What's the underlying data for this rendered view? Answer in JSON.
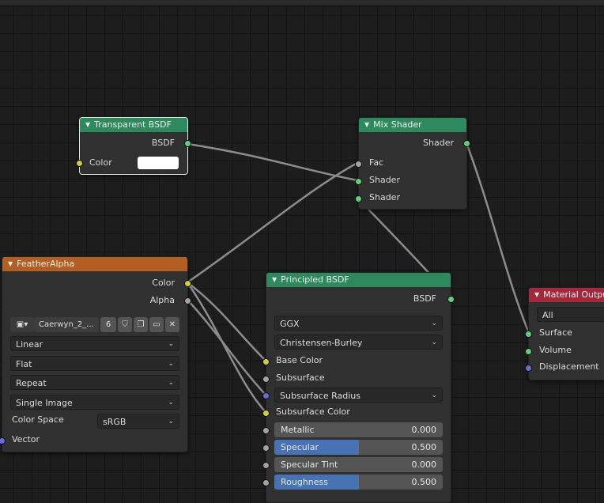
{
  "colors": {
    "green_header": "#2e8a5e",
    "orange_header": "#b35e23",
    "red_header": "#a3283a",
    "socket_green": "#5fd07a",
    "socket_yellow": "#d6cc3a",
    "socket_gray": "#a3a3a3",
    "socket_blue": "#6b6bd8",
    "slider_blue": "#4772b3"
  },
  "transparent_bsdf": {
    "title": "Transparent BSDF",
    "output": "BSDF",
    "color_label": "Color"
  },
  "mix_shader": {
    "title": "Mix Shader",
    "output": "Shader",
    "inputs": [
      "Fac",
      "Shader",
      "Shader"
    ]
  },
  "feather_alpha": {
    "title": "FeatherAlpha",
    "outputs": [
      "Color",
      "Alpha"
    ],
    "image_name": "Caerwyn_2_...",
    "users": "6",
    "interpolation": "Linear",
    "projection": "Flat",
    "extension": "Repeat",
    "source": "Single Image",
    "color_space_label": "Color Space",
    "color_space": "sRGB",
    "vector_label": "Vector"
  },
  "principled_bsdf": {
    "title": "Principled BSDF",
    "output": "BSDF",
    "distribution": "GGX",
    "subsurface_method": "Christensen-Burley",
    "base_color": "Base Color",
    "subsurface": "Subsurface",
    "subsurface_radius": "Subsurface Radius",
    "subsurface_color": "Subsurface Color",
    "metallic": {
      "label": "Metallic",
      "value": "0.000",
      "fraction": 0.0
    },
    "specular": {
      "label": "Specular",
      "value": "0.500",
      "fraction": 0.5
    },
    "specular_tint": {
      "label": "Specular Tint",
      "value": "0.000",
      "fraction": 0.0
    },
    "roughness": {
      "label": "Roughness",
      "value": "0.500",
      "fraction": 0.5
    }
  },
  "material_output": {
    "title": "Material Output",
    "target": "All",
    "inputs": [
      "Surface",
      "Volume",
      "Displacement"
    ]
  }
}
